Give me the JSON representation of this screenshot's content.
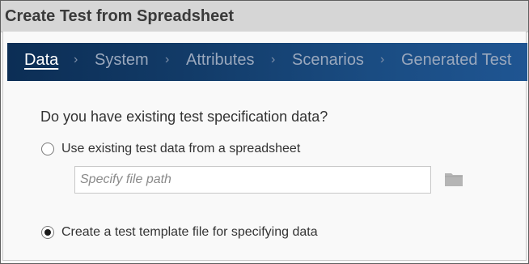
{
  "dialog": {
    "title": "Create Test from Spreadsheet"
  },
  "wizard": {
    "steps": [
      {
        "label": "Data",
        "active": true
      },
      {
        "label": "System",
        "active": false
      },
      {
        "label": "Attributes",
        "active": false
      },
      {
        "label": "Scenarios",
        "active": false
      },
      {
        "label": "Generated Test",
        "active": false
      }
    ],
    "separator": "›"
  },
  "form": {
    "question": "Do you have existing test specification data?",
    "options": [
      {
        "label": "Use existing test data from a spreadsheet",
        "selected": false
      },
      {
        "label": "Create a test template file for specifying data",
        "selected": true
      }
    ],
    "file_path": {
      "value": "",
      "placeholder": "Specify file path"
    },
    "browse_icon": "folder-icon"
  },
  "colors": {
    "wizard_bar": "#123b68",
    "title_bar": "#d6d6d6"
  }
}
